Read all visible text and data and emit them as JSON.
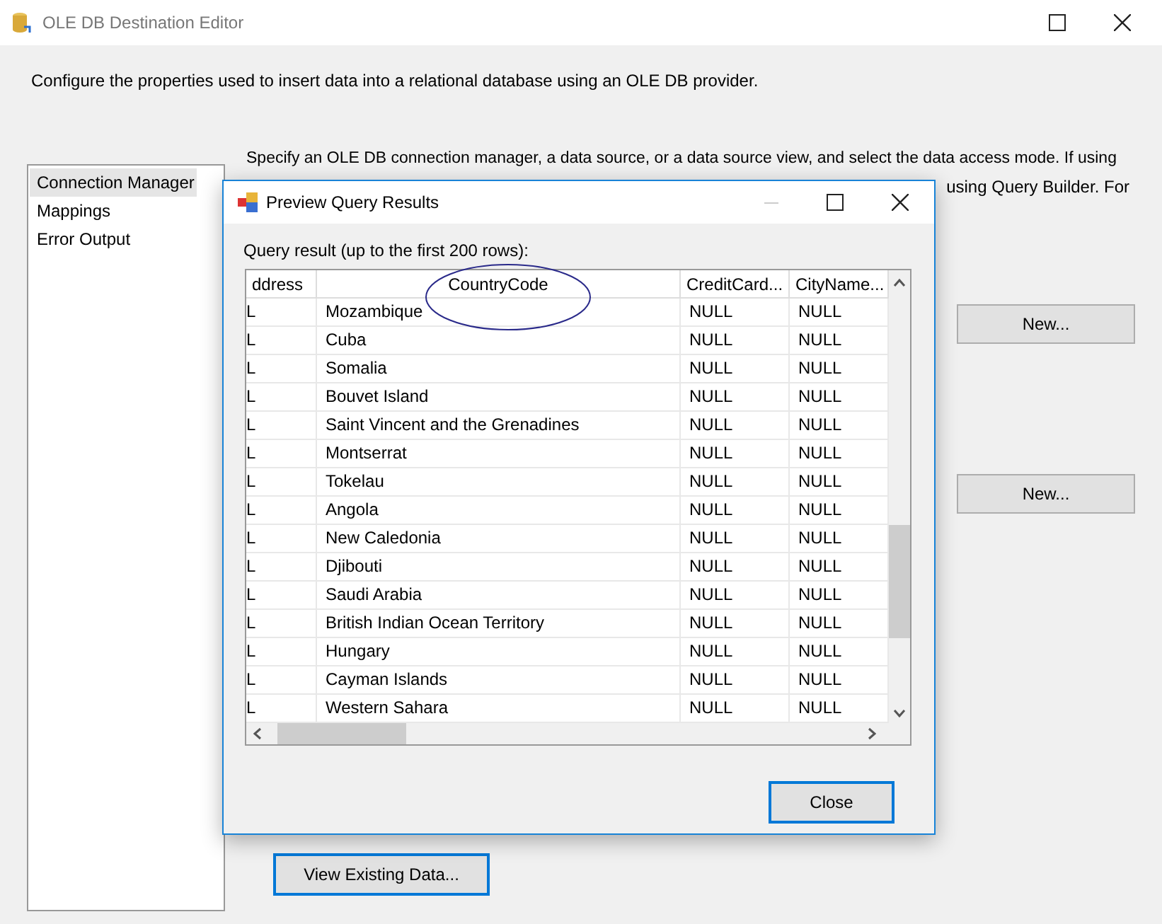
{
  "window": {
    "title": "OLE DB Destination Editor"
  },
  "description": "Configure the properties used to insert data into a relational database using an OLE DB provider.",
  "sidebar": {
    "items": [
      {
        "label": "Connection Manager",
        "selected": true
      },
      {
        "label": "Mappings",
        "selected": false
      },
      {
        "label": "Error Output",
        "selected": false
      }
    ]
  },
  "content": {
    "intro_line_1": "Specify an OLE DB connection manager, a data source, or a data source view, and select the data access mode. If using",
    "intro_line_2_fragment": "using Query Builder. For",
    "new_buttons": [
      "New...",
      "New..."
    ],
    "view_button": "View Existing Data..."
  },
  "dialog": {
    "title": "Preview Query Results",
    "label": "Query result (up to the first 200 rows):",
    "columns": [
      "ddress",
      "CountryCode",
      "CreditCard...",
      "CityName..."
    ],
    "rows": [
      [
        "L",
        "Mozambique",
        "NULL",
        "NULL"
      ],
      [
        "L",
        "Cuba",
        "NULL",
        "NULL"
      ],
      [
        "L",
        "Somalia",
        "NULL",
        "NULL"
      ],
      [
        "L",
        "Bouvet Island",
        "NULL",
        "NULL"
      ],
      [
        "L",
        "Saint Vincent and the Grenadines",
        "NULL",
        "NULL"
      ],
      [
        "L",
        "Montserrat",
        "NULL",
        "NULL"
      ],
      [
        "L",
        "Tokelau",
        "NULL",
        "NULL"
      ],
      [
        "L",
        "Angola",
        "NULL",
        "NULL"
      ],
      [
        "L",
        "New Caledonia",
        "NULL",
        "NULL"
      ],
      [
        "L",
        "Djibouti",
        "NULL",
        "NULL"
      ],
      [
        "L",
        "Saudi Arabia",
        "NULL",
        "NULL"
      ],
      [
        "L",
        "British Indian Ocean Territory",
        "NULL",
        "NULL"
      ],
      [
        "L",
        "Hungary",
        "NULL",
        "NULL"
      ],
      [
        "L",
        "Cayman Islands",
        "NULL",
        "NULL"
      ],
      [
        "L",
        "Western Sahara",
        "NULL",
        "NULL"
      ]
    ],
    "close_button": "Close"
  }
}
